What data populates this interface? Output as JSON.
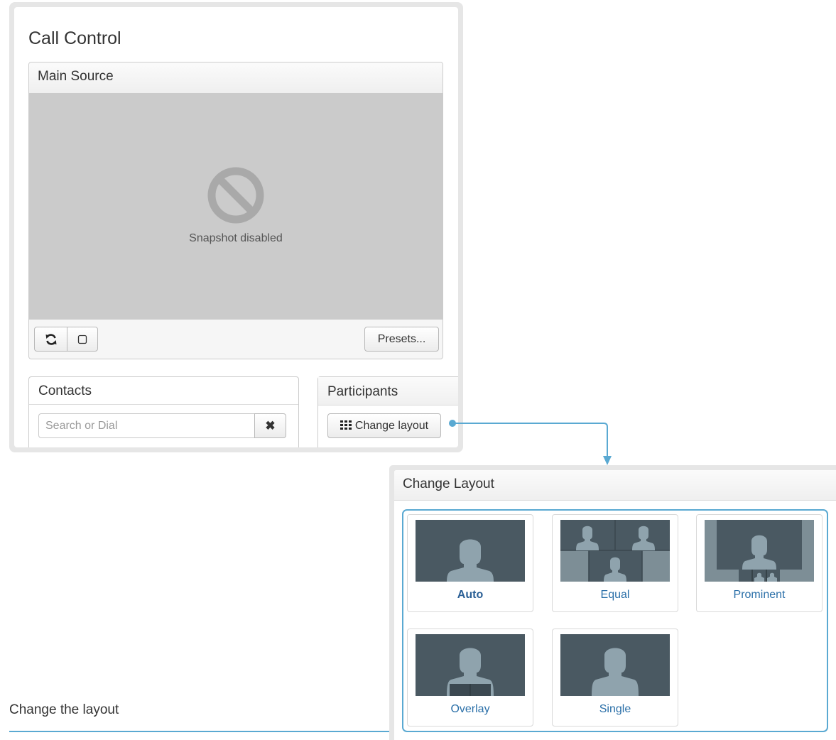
{
  "call_control": {
    "title": "Call Control",
    "main_source": {
      "heading": "Main Source",
      "snapshot_text": "Snapshot disabled",
      "presets_label": "Presets..."
    },
    "contacts": {
      "heading": "Contacts",
      "search_placeholder": "Search or Dial",
      "clear_icon": "close-icon"
    },
    "participants": {
      "heading": "Participants",
      "change_layout_label": "Change layout",
      "change_layout_icon": "grid-icon"
    }
  },
  "change_layout": {
    "heading": "Change Layout",
    "selected": "Auto",
    "options": [
      {
        "label": "Auto"
      },
      {
        "label": "Equal"
      },
      {
        "label": "Prominent"
      },
      {
        "label": "Overlay"
      },
      {
        "label": "Single"
      }
    ]
  },
  "caption": "Change the layout",
  "colors": {
    "accent": "#5aa9d2",
    "link": "#2a6fa8",
    "thumb_bg": "#4a5962",
    "person": "#8fa3ad"
  }
}
